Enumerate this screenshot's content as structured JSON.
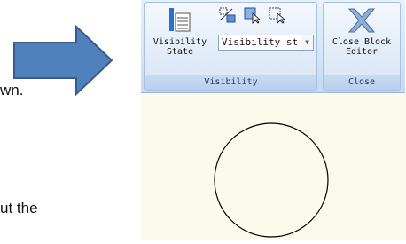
{
  "document": {
    "line1_fragment": "wn.",
    "line2_fragment": "ut the"
  },
  "ribbon": {
    "groups": [
      {
        "label": "Visibility",
        "buttons": [
          {
            "icon": "visibility-state-icon",
            "label_line1": "Visibility",
            "label_line2": "State"
          }
        ],
        "small_icons": [
          "toggle-visibility-icon",
          "make-visible-icon",
          "make-invisible-icon"
        ],
        "combo_value": "Visibility st"
      },
      {
        "label": "Close",
        "buttons": [
          {
            "icon": "close-editor-x-icon",
            "label_line1": "Close Block",
            "label_line2": "Editor"
          }
        ]
      }
    ]
  },
  "colors": {
    "arrow_fill": "#4f81bd",
    "canvas_bg": "#fcfaea",
    "ribbon_bg": "#d2e2f5"
  }
}
